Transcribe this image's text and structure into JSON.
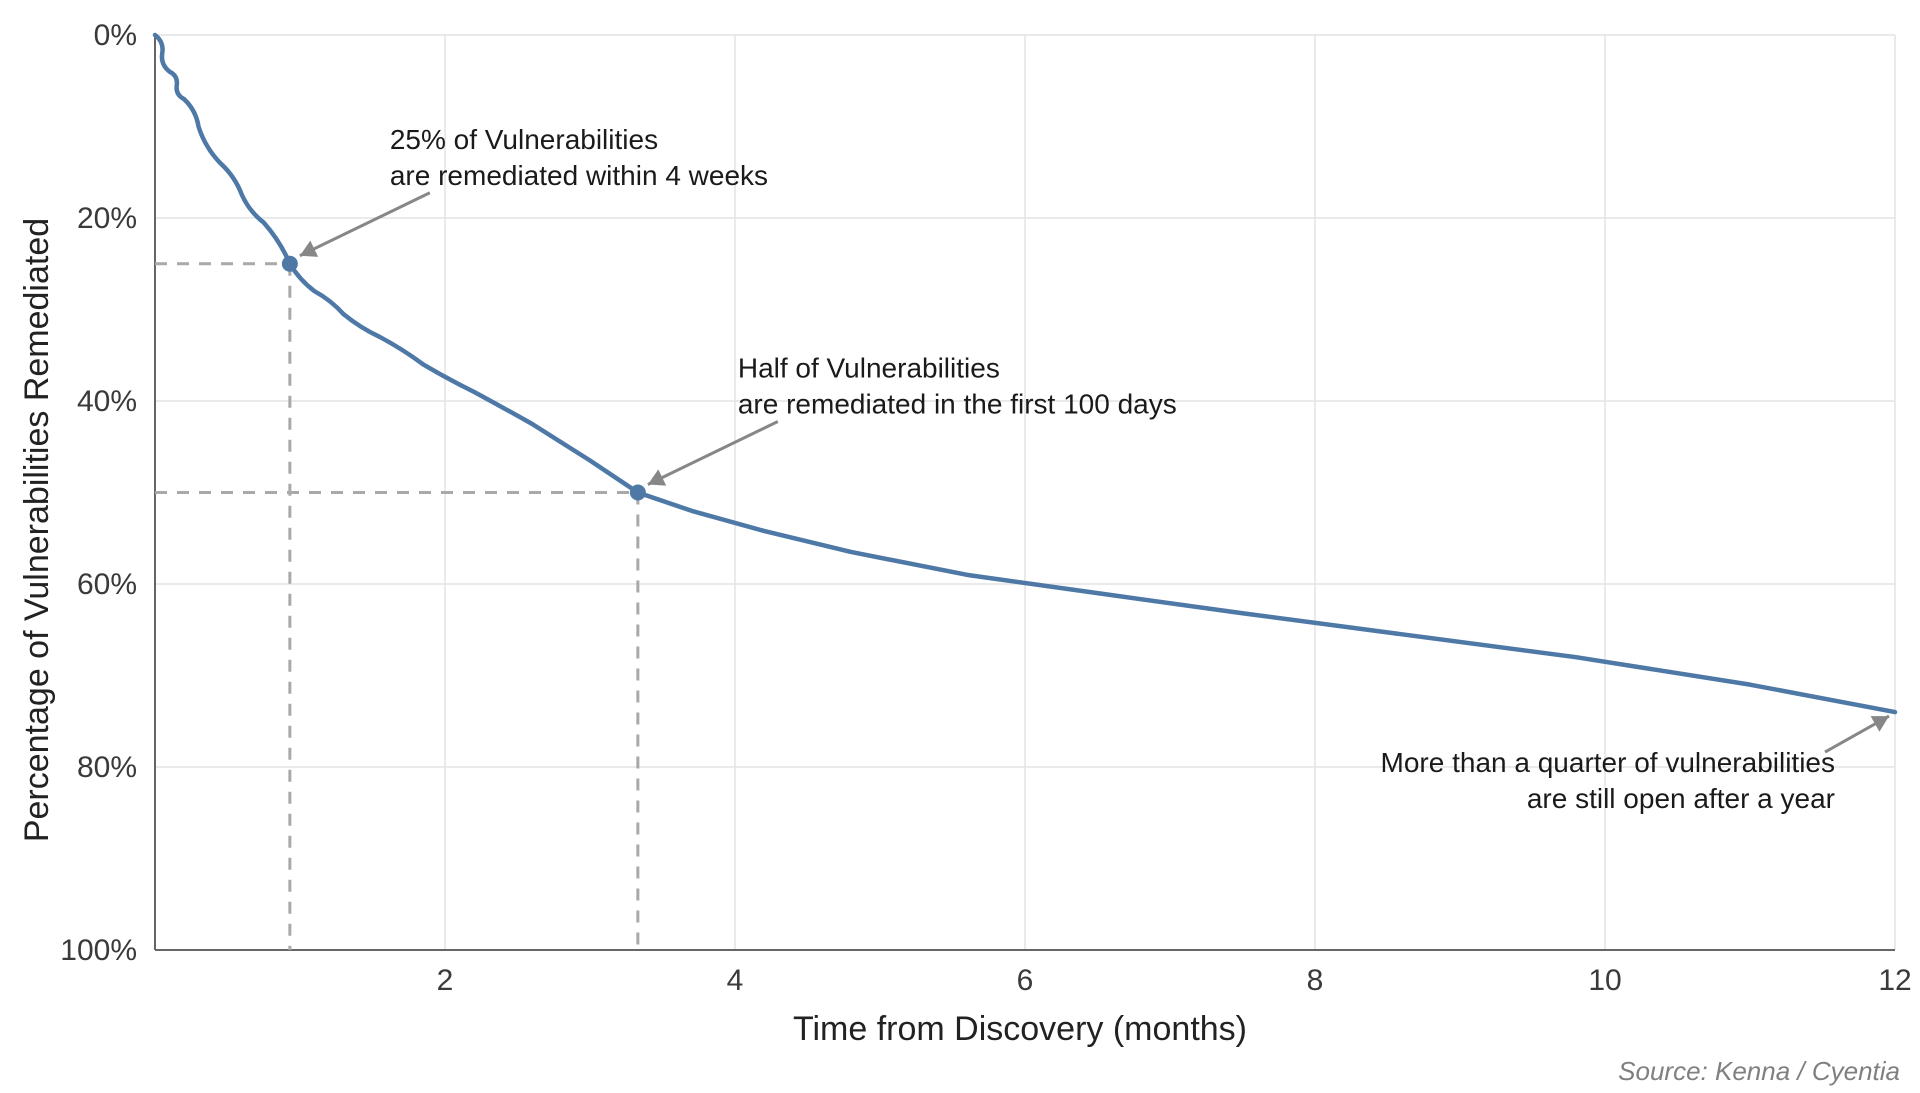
{
  "chart_data": {
    "type": "line",
    "xlabel": "Time from Discovery (months)",
    "ylabel": "Percentage of Vulnerabilities Remediated",
    "xlim": [
      0,
      12
    ],
    "ylim": [
      0,
      100
    ],
    "x_ticks": [
      2,
      4,
      6,
      8,
      10,
      12
    ],
    "y_ticks": [
      0,
      20,
      40,
      60,
      80,
      100
    ],
    "y_tick_labels": [
      "0%",
      "20%",
      "40%",
      "60%",
      "80%",
      "100%"
    ],
    "series": [
      {
        "name": "Remediation survival curve",
        "x": [
          0,
          0.05,
          0.1,
          0.15,
          0.2,
          0.3,
          0.45,
          0.6,
          0.75,
          0.93,
          1.1,
          1.3,
          1.55,
          1.85,
          2.2,
          2.6,
          3.0,
          3.33,
          3.7,
          4.2,
          4.8,
          5.6,
          6.5,
          7.5,
          8.6,
          9.8,
          11.0,
          12.0
        ],
        "y": [
          0,
          2,
          4,
          5.5,
          7,
          10,
          14,
          17.5,
          20.5,
          25,
          28,
          30.5,
          33,
          36,
          39,
          42.5,
          46.5,
          50,
          52,
          54.2,
          56.5,
          59,
          61,
          63.2,
          65.5,
          68,
          71,
          74
        ]
      }
    ],
    "annotations": [
      {
        "id": "p25",
        "line1": "25% of Vulnerabilities",
        "line2": "are remediated within 4 weeks",
        "x": 0.93,
        "y": 25
      },
      {
        "id": "p50",
        "line1": "Half of Vulnerabilities",
        "line2": "are remediated in the first 100 days",
        "x": 3.33,
        "y": 50
      },
      {
        "id": "p_year",
        "line1": "More than a quarter of vulnerabilities",
        "line2": "are still open after a year",
        "x": 12.0,
        "y": 74
      }
    ],
    "source": "Source: Kenna / Cyentia"
  }
}
